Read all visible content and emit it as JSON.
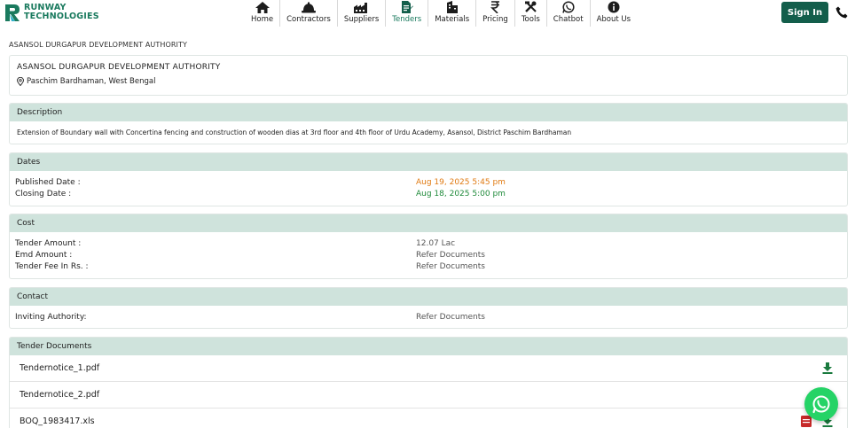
{
  "brand": {
    "line1": "RUNWAY",
    "line2": "TECHNOLOGIES",
    "color": "#1a7a5e"
  },
  "nav": {
    "items": [
      {
        "label": "Home",
        "icon": "home-icon"
      },
      {
        "label": "Contractors",
        "icon": "hardhat-icon"
      },
      {
        "label": "Suppliers",
        "icon": "factory-icon"
      },
      {
        "label": "Tenders",
        "icon": "tender-doc-icon",
        "active": true
      },
      {
        "label": "Materials",
        "icon": "building-icon"
      },
      {
        "label": "Pricing",
        "icon": "rupee-icon"
      },
      {
        "label": "Tools",
        "icon": "tools-icon"
      },
      {
        "label": "Chatbot",
        "icon": "whatsapp-icon"
      },
      {
        "label": "About Us",
        "icon": "info-icon"
      }
    ],
    "signin_label": "Sign In"
  },
  "breadcrumb": "ASANSOL DURGAPUR DEVELOPMENT AUTHORITY",
  "org": {
    "name": "ASANSOL DURGAPUR DEVELOPMENT AUTHORITY",
    "location": "Paschim Bardhaman, West Bengal"
  },
  "description": {
    "title": "Description",
    "text": "Extension of Boundary wall with Concertina fencing and construction of wooden dias at 3rd floor and 4th floor of Urdu Academy, Asansol, District Paschim Bardhaman"
  },
  "dates": {
    "title": "Dates",
    "published_label": "Published Date :",
    "published_value": "Aug 19, 2025 5:45 pm",
    "closing_label": "Closing Date :",
    "closing_value": "Aug 18, 2025 5:00 pm"
  },
  "cost": {
    "title": "Cost",
    "tender_amount_label": "Tender Amount :",
    "tender_amount_value": "12.07 Lac",
    "emd_label": "Emd Amount :",
    "emd_value": "Refer Documents",
    "fee_label": "Tender Fee In Rs. :",
    "fee_value": "Refer Documents"
  },
  "contact": {
    "title": "Contact",
    "authority_label": "Inviting Authority:",
    "authority_value": "Refer Documents"
  },
  "documents": {
    "title": "Tender Documents",
    "files": [
      "Tendernotice_1.pdf",
      "Tendernotice_2.pdf",
      "BOQ_1983417.xls"
    ]
  },
  "colors": {
    "accent": "#135e4b",
    "section_header": "#cfe3dc",
    "published": "#e07a12",
    "closing": "#1f8a3a",
    "whatsapp": "#25d366"
  }
}
